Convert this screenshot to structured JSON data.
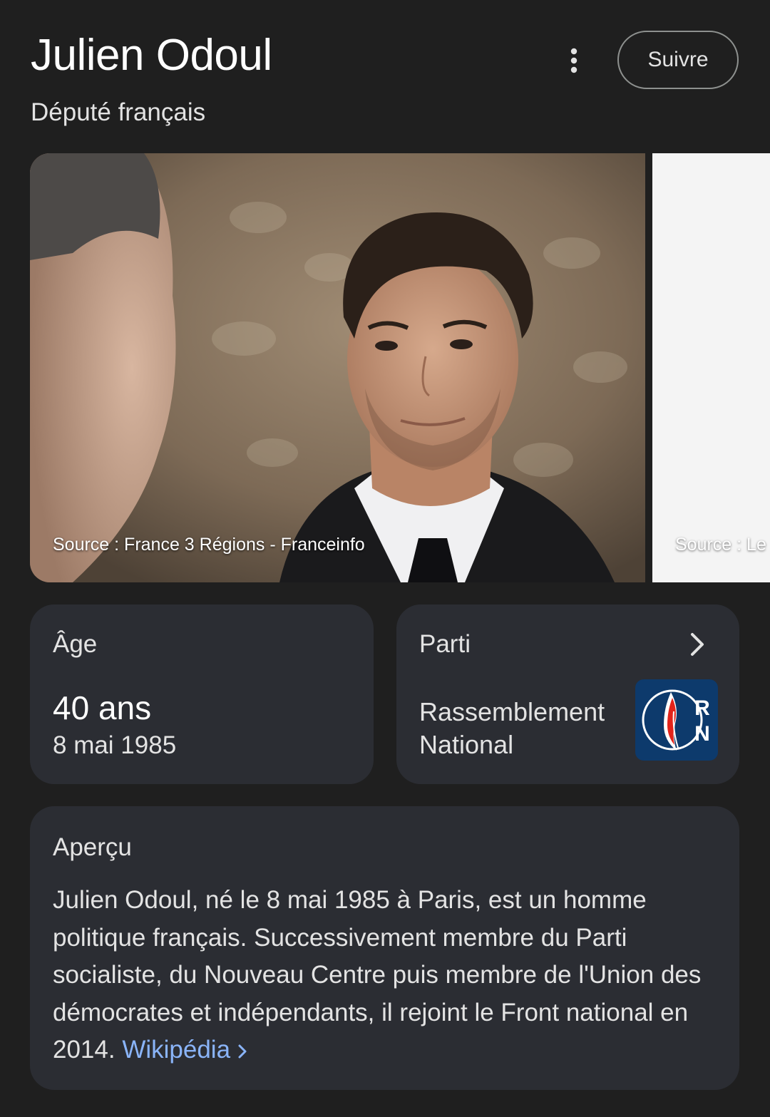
{
  "header": {
    "title": "Julien Odoul",
    "subtitle": "Député français",
    "follow_label": "Suivre",
    "more_icon": "more-vert-icon"
  },
  "carousel": {
    "images": [
      {
        "caption": "Source : France 3 Régions - Franceinfo"
      },
      {
        "caption": "Source : Le"
      }
    ]
  },
  "age_card": {
    "label": "Âge",
    "value": "40 ans",
    "birthdate": "8 mai 1985"
  },
  "party_card": {
    "label": "Parti",
    "name": "Rassemblement National",
    "logo_text_1": "R",
    "logo_text_2": "N",
    "chevron_icon": "chevron-right-icon"
  },
  "overview_card": {
    "label": "Aperçu",
    "text": "Julien Odoul, né le 8 mai 1985 à Paris, est un homme politique français. Successivement membre du Parti socialiste, du Nouveau Centre puis membre de l'Union des démocrates et indépendants, il rejoint le Front national en 2014. ",
    "link_label": "Wikipédia"
  },
  "colors": {
    "background": "#1f1f1f",
    "card": "#2b2d33",
    "link": "#8ab4f8",
    "party_logo_bg": "#0d3a6c"
  }
}
